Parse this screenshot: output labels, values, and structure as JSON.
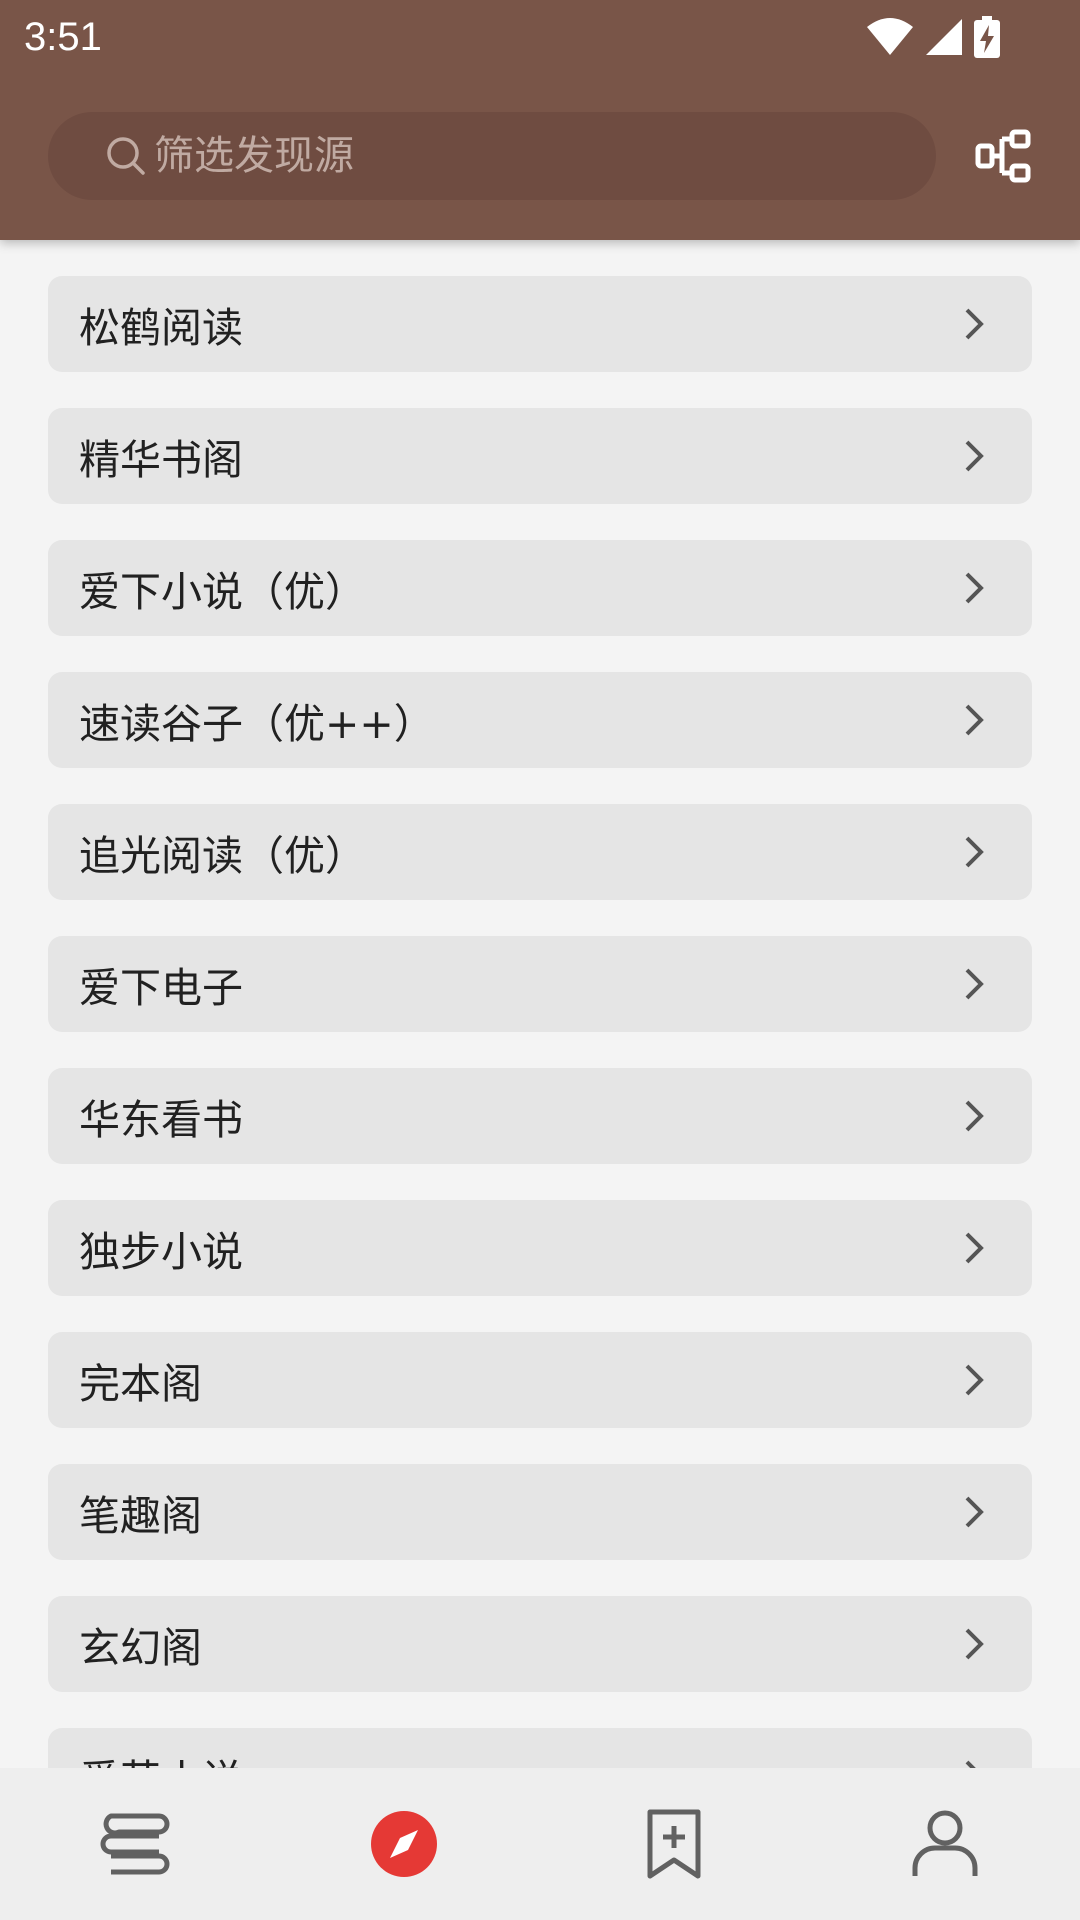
{
  "status_bar": {
    "time": "3:51"
  },
  "header": {
    "search_placeholder": "筛选发现源",
    "background_color": "#795548",
    "right_icon": "explore-config-icon"
  },
  "list": {
    "items": [
      {
        "label": "松鹤阅读"
      },
      {
        "label": "精华书阁"
      },
      {
        "label": "爱下小说（优）"
      },
      {
        "label": "速读谷子（优++）"
      },
      {
        "label": "追光阅读（优）"
      },
      {
        "label": "爱下电子"
      },
      {
        "label": "华东看书"
      },
      {
        "label": "独步小说"
      },
      {
        "label": "完本阁"
      },
      {
        "label": "笔趣阁"
      },
      {
        "label": "玄幻阁"
      },
      {
        "label": "爱苦小说"
      }
    ]
  },
  "bottom_nav": {
    "items": [
      {
        "icon": "bookshelf-icon",
        "active": false
      },
      {
        "icon": "explore-compass-icon",
        "active": true
      },
      {
        "icon": "rss-bookmark-icon",
        "active": false
      },
      {
        "icon": "profile-icon",
        "active": false
      }
    ],
    "active_color": "#e53935",
    "inactive_color": "#616161"
  }
}
